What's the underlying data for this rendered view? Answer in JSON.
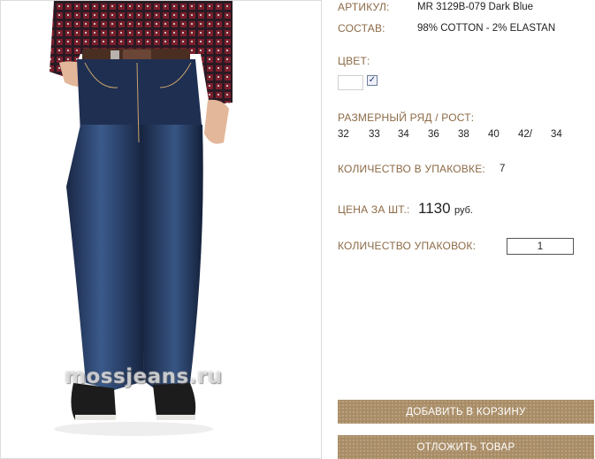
{
  "product_image": {
    "watermark": "mossjeans.ru"
  },
  "details": {
    "article_label": "АРТИКУЛ:",
    "article_value": "MR 3129B-079 Dark Blue",
    "composition_label": "СОСТАВ:",
    "composition_value": "98% COTTON - 2% ELASTAN",
    "color_label": "ЦВЕТ:",
    "color_checked_mark": "✓",
    "sizes_label": "РАЗМЕРНЫЙ РЯД / РОСТ:",
    "sizes": [
      "32",
      "33",
      "34",
      "36",
      "38",
      "40",
      "42/",
      "34"
    ],
    "pack_qty_label": "КОЛИЧЕСТВО В УПАКОВКЕ:",
    "pack_qty_value": "7",
    "price_label": "ЦЕНА ЗА ШТ.:",
    "price_value": "1130",
    "price_unit": "руб.",
    "packs_label": "КОЛИЧЕСТВО УПАКОВОК:",
    "packs_value": "1"
  },
  "actions": {
    "add_to_cart": "ДОБАВИТЬ В КОРЗИНУ",
    "postpone": "ОТЛОЖИТЬ ТОВАР"
  },
  "colors": {
    "label": "#8c6a46",
    "button": "#a98d67",
    "denim": "#1f2f52"
  }
}
